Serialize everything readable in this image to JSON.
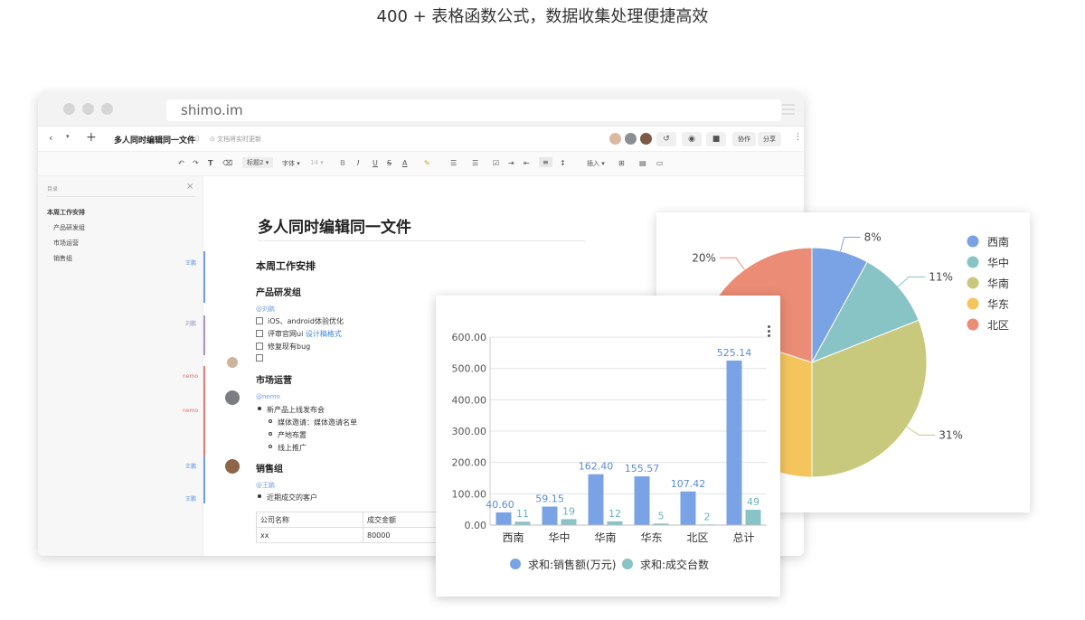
{
  "heading": "400 + 表格函数公式，数据收集处理便捷高效",
  "browser": {
    "url": "shimo.im",
    "doc_title_tab": "多人同时编辑同一文件",
    "save_status": "文档将实时更新",
    "buttons": {
      "collab": "协作",
      "share": "分享"
    }
  },
  "format_toolbar": {
    "heading_select": "标题2",
    "font_select": "字体",
    "size_select": "14",
    "insert": "插入"
  },
  "sidebar": {
    "title": "目录",
    "items": [
      {
        "label": "本周工作安排"
      },
      {
        "label": "产品研发组"
      },
      {
        "label": "市场运营"
      },
      {
        "label": "销售组"
      }
    ]
  },
  "document": {
    "title": "多人同时编辑同一文件",
    "section_title": "本周工作安排",
    "group1": {
      "title": "产品研发组",
      "mention": "@刘鹏",
      "tasks": [
        "iOS、android体验优化",
        "评审官网ui",
        "修复现有bug",
        ""
      ],
      "task2_link": "设计稿格式"
    },
    "group2": {
      "title": "市场运营",
      "mention": "@nemo",
      "bullet": "新产品上线发布会",
      "sub_bullets": [
        "媒体邀请：媒体邀请名单",
        "产地布置",
        "线上推广"
      ]
    },
    "group3": {
      "title": "销售组",
      "mention": "@王鹏",
      "bullet": "近期成交的客户"
    },
    "table": {
      "headers": [
        "公司名称",
        "成交金额"
      ],
      "rows": [
        [
          "xx",
          "80000"
        ]
      ]
    },
    "gutter_authors": [
      "王鹏",
      "刘鹏",
      "nemo",
      "nemo",
      "王鹏",
      "王鹏"
    ]
  },
  "colors": {
    "blue": "#7aa3e5",
    "teal": "#88c3c6",
    "olive": "#c9c97e",
    "yellow": "#f4c55c",
    "salmon": "#eb8c76"
  },
  "chart_data": [
    {
      "type": "pie",
      "legend": [
        "西南",
        "华中",
        "华南",
        "华东",
        "北区"
      ],
      "values": [
        8,
        11,
        31,
        30,
        20
      ],
      "labels": [
        "8%",
        "11%",
        "31%",
        "",
        "20%"
      ],
      "legend_position": "right"
    },
    {
      "type": "bar",
      "categories": [
        "西南",
        "华中",
        "华南",
        "华东",
        "北区",
        "总计"
      ],
      "series": [
        {
          "name": "求和:销售额(万元)",
          "values": [
            40.6,
            59.15,
            162.4,
            155.57,
            107.42,
            525.14
          ],
          "labels": [
            "40.60",
            "59.15",
            "162.40",
            "155.57",
            "107.42",
            "525.14"
          ]
        },
        {
          "name": "求和:成交台数",
          "values": [
            11,
            19,
            12,
            5,
            2,
            49
          ],
          "labels": [
            "11",
            "19",
            "12",
            "5",
            "2",
            "49"
          ]
        }
      ],
      "yticks": [
        "0.00",
        "100.00",
        "200.00",
        "300.00",
        "400.00",
        "500.00",
        "600.00"
      ],
      "ylim": [
        0,
        600
      ],
      "grid": true,
      "legend_position": "bottom"
    }
  ]
}
